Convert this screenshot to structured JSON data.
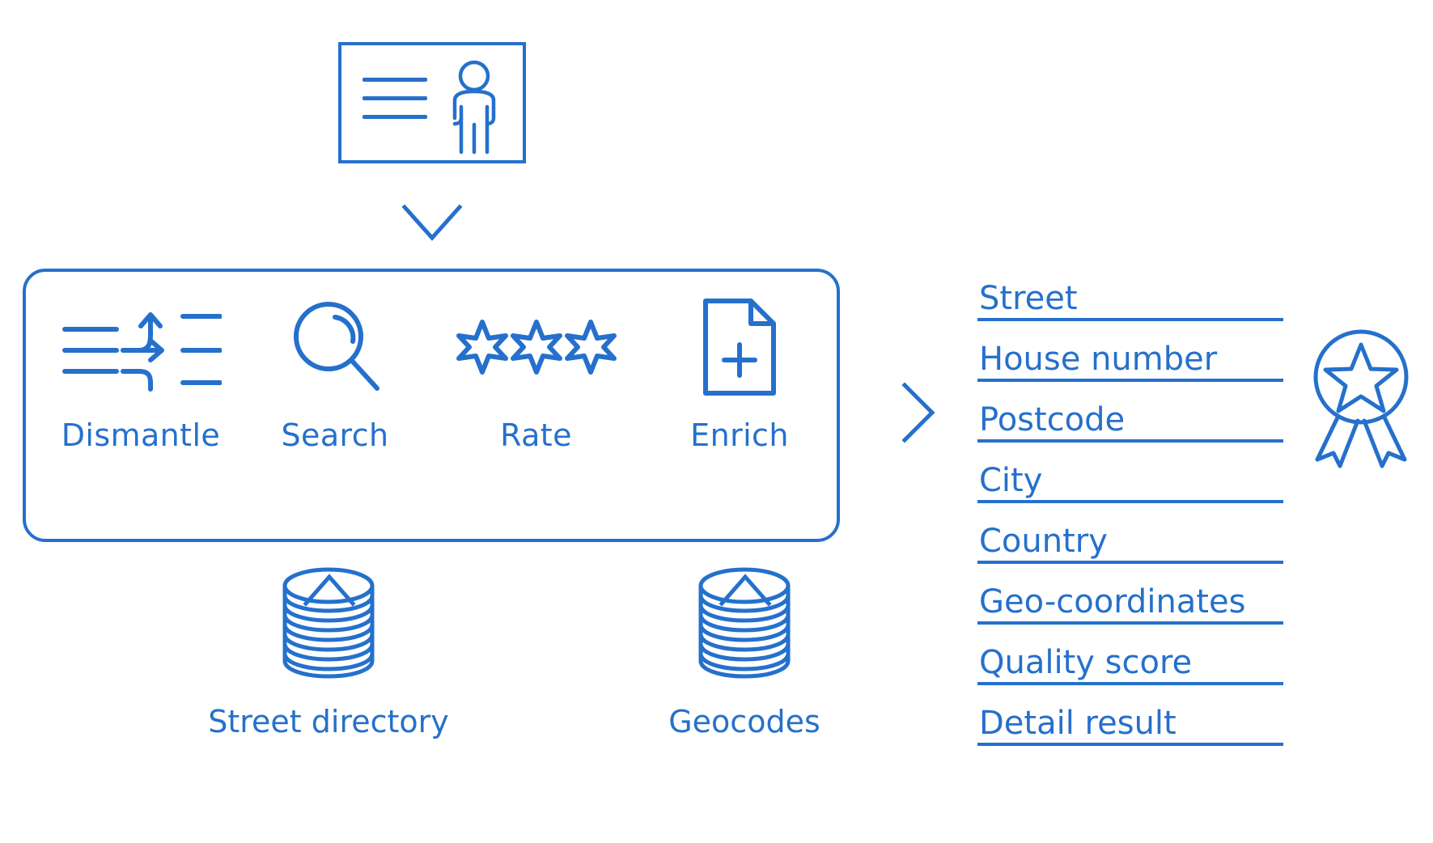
{
  "colors": {
    "accent": "#2570cc",
    "background": "#ffffff"
  },
  "input": {
    "name": "address-record-card",
    "icon": "person-with-text-lines-icon",
    "line_count": 3
  },
  "flow_arrows": {
    "into_pipeline": "chevron-down-icon",
    "from_street_directory": "chevron-up-icon",
    "from_geocodes": "chevron-up-icon",
    "to_output": "chevron-right-icon"
  },
  "pipeline": {
    "name": "address-validation-pipeline",
    "steps": [
      {
        "label": "Dismantle",
        "icon": "split-lines-arrows-icon"
      },
      {
        "label": "Search",
        "icon": "magnifier-icon"
      },
      {
        "label": "Rate",
        "icon": "three-stars-icon",
        "star_count": 3
      },
      {
        "label": "Enrich",
        "icon": "document-plus-icon"
      }
    ]
  },
  "sources": [
    {
      "label": "Street directory",
      "icon": "database-stack-icon"
    },
    {
      "label": "Geocodes",
      "icon": "database-stack-icon"
    }
  ],
  "output": {
    "name": "enriched-address-fields",
    "fields": [
      "Street",
      "House number",
      "Postcode",
      "City",
      "Country",
      "Geo-coordinates",
      "Quality score",
      "Detail result"
    ],
    "seal": {
      "icon": "award-rosette-star-icon",
      "label": ""
    }
  }
}
